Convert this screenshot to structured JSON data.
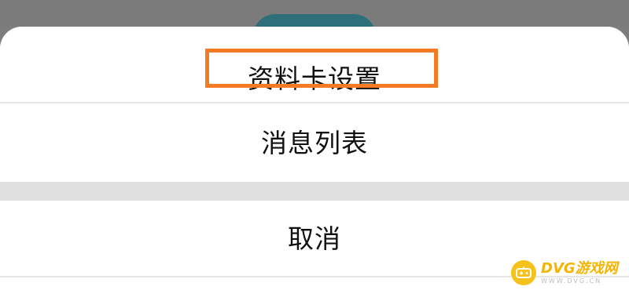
{
  "sheet": {
    "options": [
      {
        "label": "资料卡设置"
      },
      {
        "label": "消息列表"
      }
    ],
    "cancel_label": "取消"
  },
  "watermark": {
    "title": "DVG游戏网",
    "subtitle": "WWW.DVG.CN"
  },
  "colors": {
    "highlight": "#f47a23",
    "background_fab": "#2f6f7a",
    "overlay": "#7b7b7b",
    "watermark_accent": "#f6c21a"
  },
  "icons": {
    "watermark_logo": "gamepad-icon"
  }
}
